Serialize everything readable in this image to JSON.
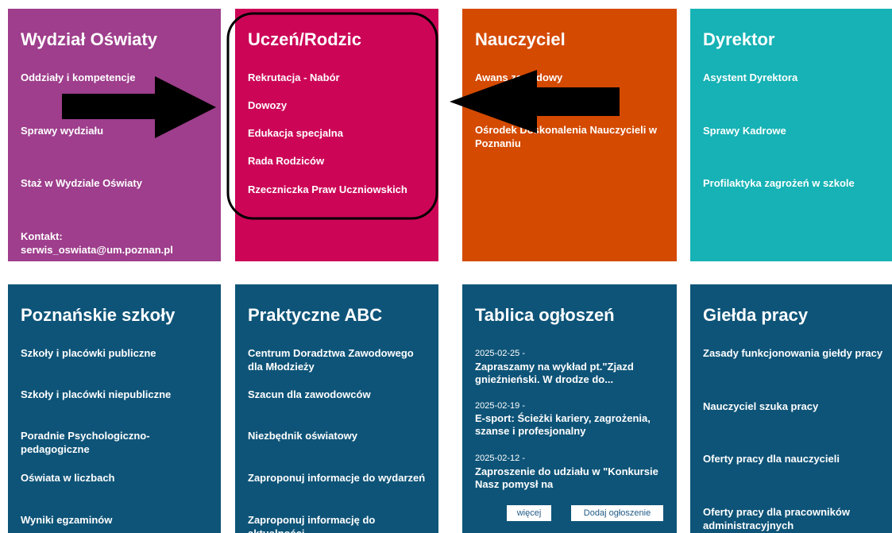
{
  "colors": {
    "wydzial": "#9e3e8c",
    "uczen": "#cc0557",
    "nauczyciel": "#d44a00",
    "dyrektor": "#16b2b5",
    "bottom": "#0e5478",
    "button_text": "#1f5a86"
  },
  "tiles": {
    "wydzial": {
      "title": "Wydział Oświaty",
      "links": [
        "Oddziały i kompetencje",
        "Sprawy wydziału",
        "Staż w Wydziale Oświaty"
      ],
      "contact_label": "Kontakt:",
      "contact_email": "serwis_oswiata@um.poznan.pl"
    },
    "uczen": {
      "title": "Uczeń/Rodzic",
      "links": [
        "Rekrutacja - Nabór",
        "Dowozy",
        "Edukacja specjalna",
        "Rada Rodziców",
        "Rzeczniczka Praw Uczniowskich"
      ]
    },
    "nauczyciel": {
      "title": "Nauczyciel",
      "links": [
        "Awans zawodowy",
        "Ośrodek Doskonalenia Nauczycieli w Poznaniu"
      ]
    },
    "dyrektor": {
      "title": "Dyrektor",
      "links": [
        "Asystent Dyrektora",
        "Sprawy Kadrowe",
        "Profilaktyka zagrożeń w szkole"
      ]
    },
    "szkoly": {
      "title": "Poznańskie szkoły",
      "links": [
        "Szkoły i placówki publiczne",
        "Szkoły i placówki niepubliczne",
        "Poradnie Psychologiczno-pedagogiczne",
        "Oświata w liczbach",
        "Wyniki egzaminów"
      ]
    },
    "abc": {
      "title": "Praktyczne ABC",
      "links": [
        "Centrum Doradztwa Zawodowego dla Młodzieży",
        "Szacun dla zawodowców",
        "Niezbędnik oświatowy",
        "Zaproponuj informacje do wydarzeń",
        "Zaproponuj informację do aktualności"
      ]
    },
    "tablica": {
      "title": "Tablica ogłoszeń",
      "items": [
        {
          "date": "2025-02-25 -",
          "title": "Zapraszamy na wykład pt.\"Zjazd gnieźnieński. W drodze do..."
        },
        {
          "date": "2025-02-19 -",
          "title": "E-sport: Ścieżki kariery, zagrożenia, szanse i profesjonalny"
        },
        {
          "date": "2025-02-12 -",
          "title": "Zaproszenie do udziału w \"Konkursie Nasz pomysł na"
        }
      ],
      "more_label": "więcej",
      "add_label": "Dodaj ogłoszenie"
    },
    "gielda": {
      "title": "Giełda pracy",
      "links": [
        "Zasady funkcjonowania giełdy pracy",
        "Nauczyciel szuka pracy",
        "Oferty pracy dla nauczycieli",
        "Oferty pracy dla pracowników administracyjnych"
      ]
    }
  }
}
